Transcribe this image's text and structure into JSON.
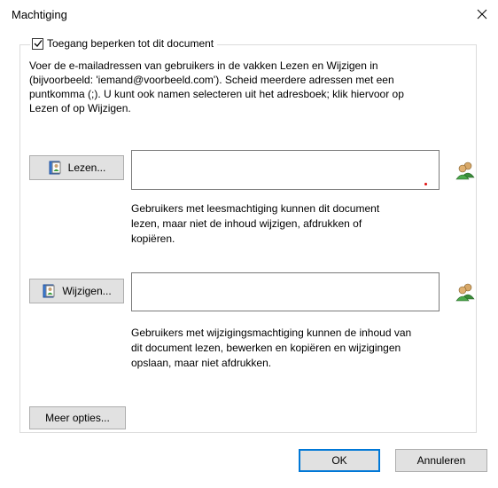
{
  "window": {
    "title": "Machtiging",
    "close_icon": "close-icon"
  },
  "restrict": {
    "checked": true,
    "label": "Toegang beperken tot dit document"
  },
  "description": {
    "line1": "Voer de e-mailadressen van gebruikers in de vakken Lezen en Wijzigen in",
    "line2": "(bijvoorbeeld: 'iemand@voorbeeld.com'). Scheid meerdere adressen met een",
    "line3": "puntkomma (;). U kunt ook namen selecteren uit het adresboek; klik hiervoor op",
    "line4": "Lezen of op Wijzigen."
  },
  "read": {
    "button_label": "Lezen...",
    "value": "",
    "help1": "Gebruikers met leesmachtiging kunnen dit document",
    "help2": "lezen, maar niet de inhoud wijzigen, afdrukken of",
    "help3": "kopiëren."
  },
  "change": {
    "button_label": "Wijzigen...",
    "value": "",
    "help1": "Gebruikers met wijzigingsmachtiging kunnen de inhoud van",
    "help2": "dit document lezen, bewerken en kopiëren en wijzigingen",
    "help3": "opslaan, maar niet afdrukken."
  },
  "more_options_label": "Meer opties...",
  "footer": {
    "ok_label": "OK",
    "cancel_label": "Annuleren"
  }
}
